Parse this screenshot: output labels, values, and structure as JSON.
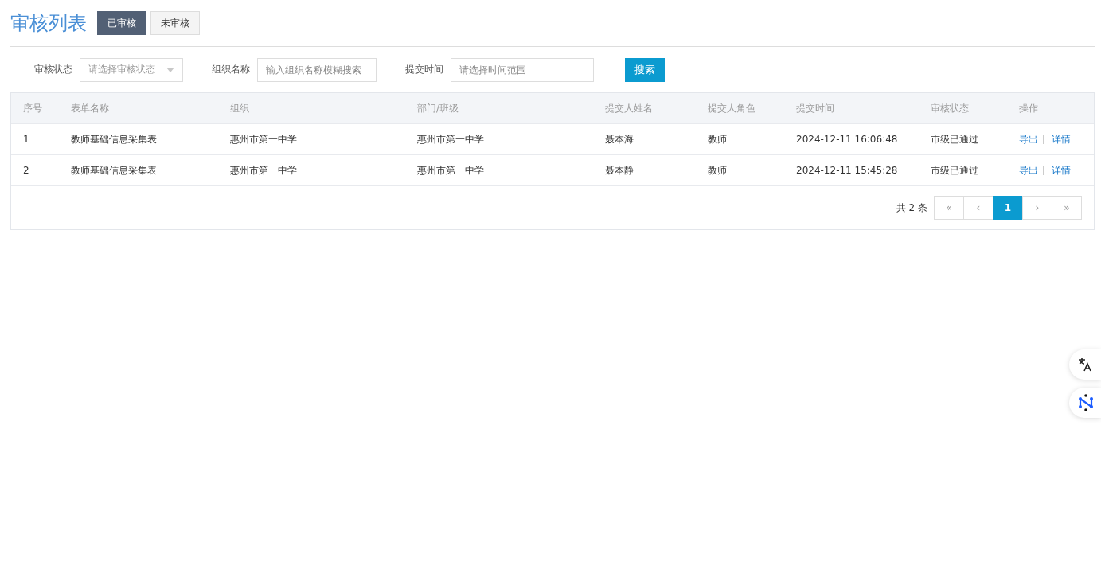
{
  "header": {
    "title": "审核列表",
    "tabs": [
      {
        "label": "已审核",
        "selected": true
      },
      {
        "label": "未审核",
        "selected": false
      }
    ]
  },
  "filters": [
    {
      "kind": "select",
      "label": "审核状态",
      "placeholder": "请选择审核状态"
    },
    {
      "kind": "input",
      "label": "组织名称",
      "placeholder": "输入组织名称模糊搜索"
    },
    {
      "kind": "input",
      "label": "提交时间",
      "placeholder": "请选择时间范围"
    }
  ],
  "search_button": "搜索",
  "table": {
    "columns": [
      "序号",
      "表单名称",
      "组织",
      "部门/班级",
      "提交人姓名",
      "提交人角色",
      "提交时间",
      "审核状态",
      "操作"
    ],
    "rows": [
      {
        "cells": [
          "1",
          "教师基础信息采集表",
          "惠州市第一中学",
          "惠州市第一中学",
          "聂本海",
          "教师",
          "2024-12-11 16:06:48",
          "市级已通过"
        ],
        "actions": [
          "导出",
          "详情"
        ]
      },
      {
        "cells": [
          "2",
          "教师基础信息采集表",
          "惠州市第一中学",
          "惠州市第一中学",
          "聂本静",
          "教师",
          "2024-12-11 15:45:28",
          "市级已通过"
        ],
        "actions": [
          "导出",
          "详情"
        ]
      }
    ]
  },
  "pagination": {
    "total": "共 2 条",
    "buttons": [
      {
        "label": "«",
        "selected": false
      },
      {
        "label": "‹",
        "selected": false
      },
      {
        "label": "1",
        "selected": true
      },
      {
        "label": "›",
        "selected": false
      },
      {
        "label": "»",
        "selected": false
      }
    ]
  }
}
